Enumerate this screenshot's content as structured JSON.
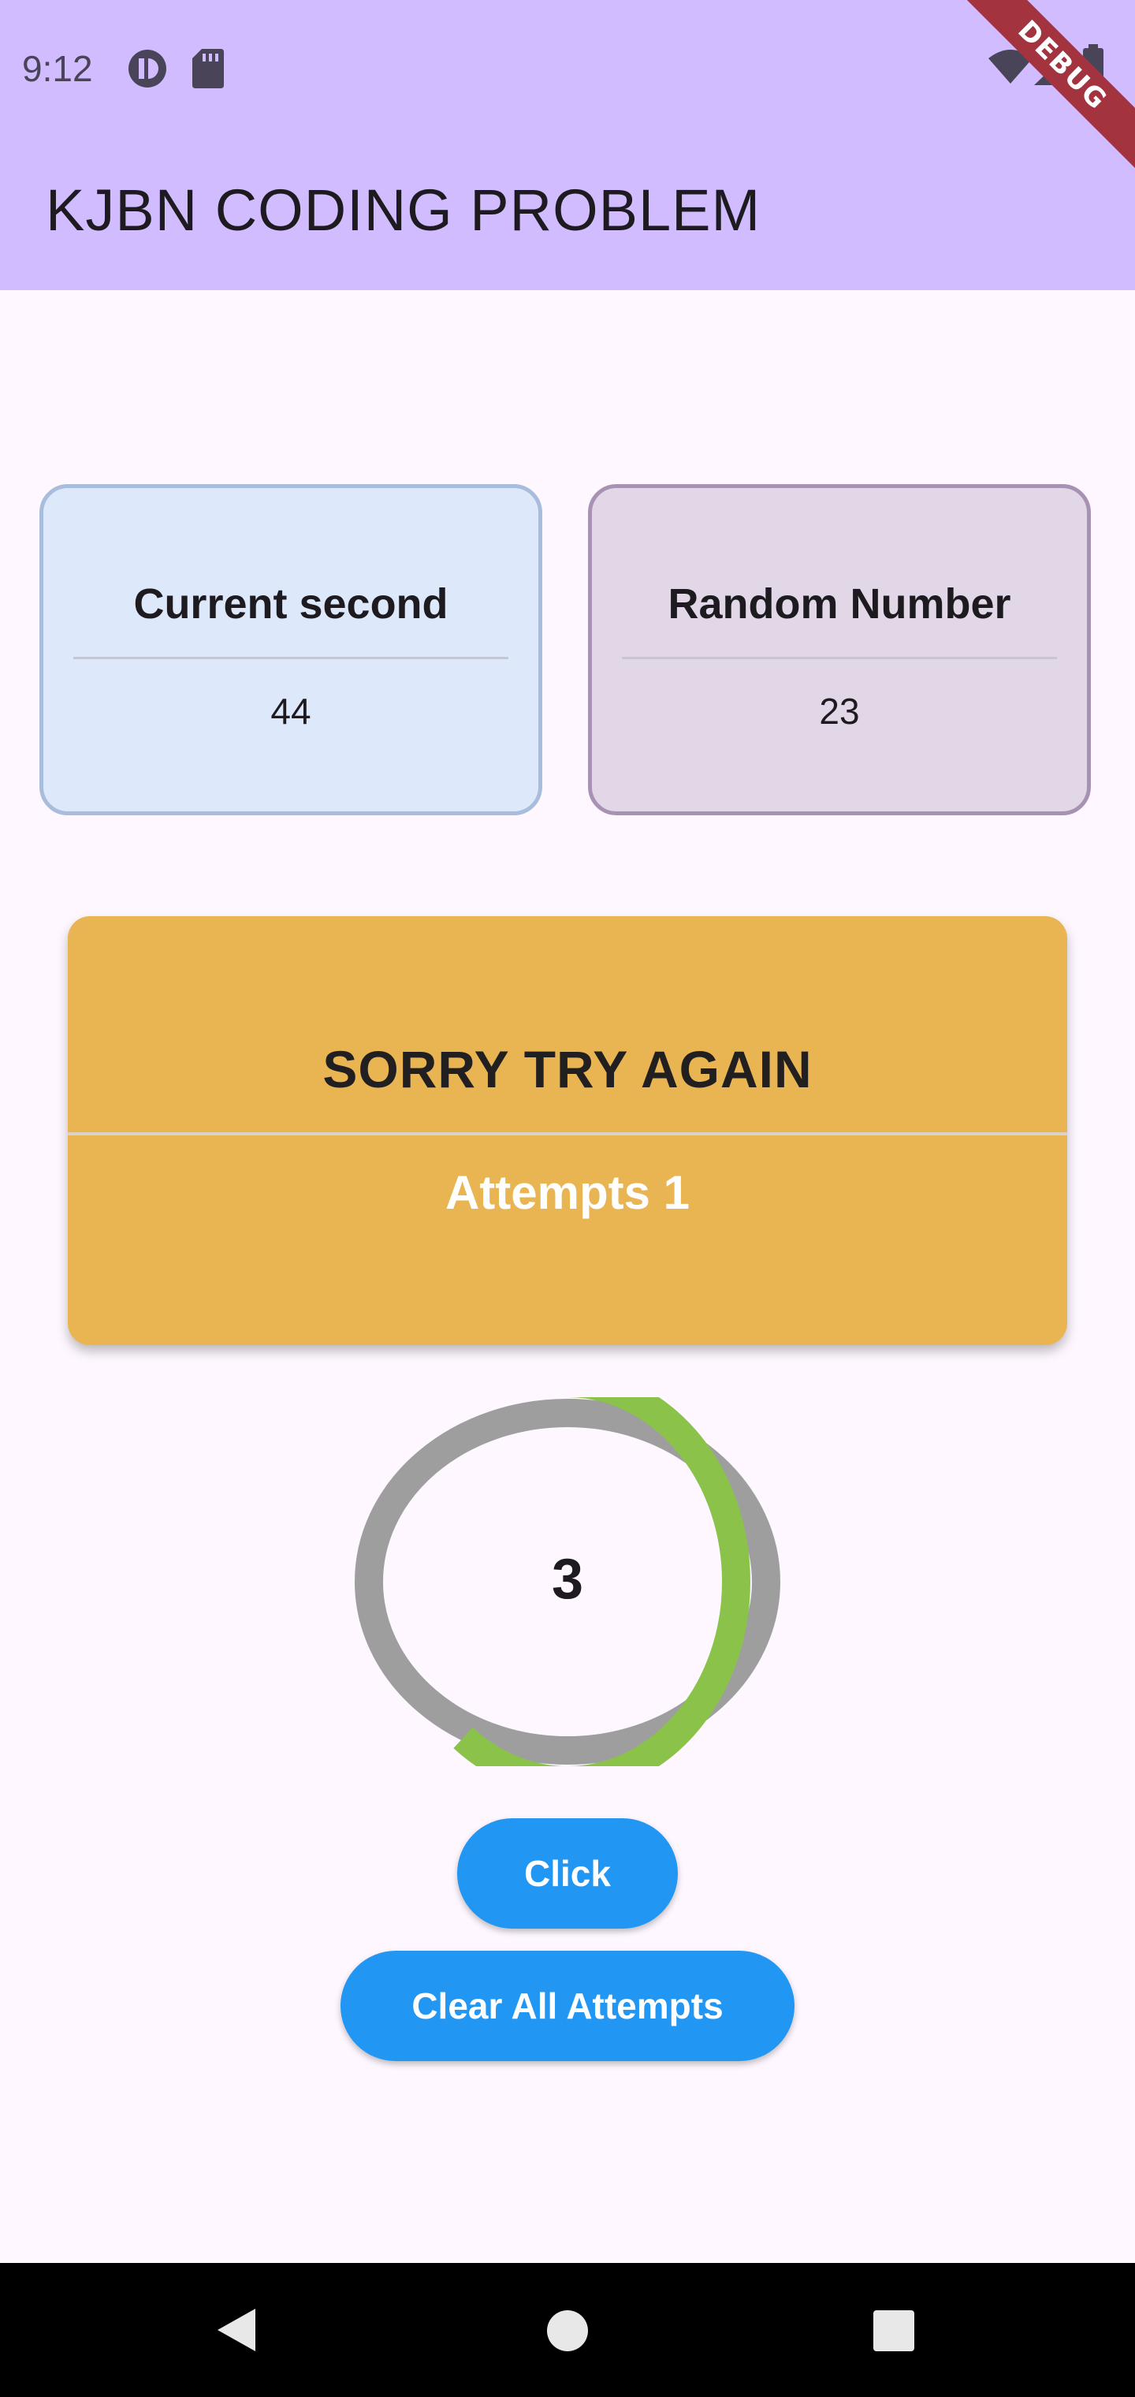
{
  "status_bar": {
    "time": "9:12",
    "icons": [
      "app-notification-icon",
      "sd-card-icon",
      "wifi-icon",
      "signal-icon",
      "battery-icon"
    ]
  },
  "debug_banner": {
    "label": "DEBUG"
  },
  "app_bar": {
    "title": "KJBN CODING PROBLEM"
  },
  "cards": {
    "current_second": {
      "title": "Current second",
      "value": "44"
    },
    "random_number": {
      "title": "Random Number",
      "value": "23"
    }
  },
  "result": {
    "title": "SORRY TRY AGAIN",
    "attempts": "Attempts 1"
  },
  "timer": {
    "count": "3",
    "progress_fraction": 0.6
  },
  "buttons": {
    "click": "Click",
    "clear": "Clear All Attempts"
  },
  "nav_bar": {
    "icons": [
      "back-icon",
      "home-icon",
      "recents-icon"
    ]
  },
  "colors": {
    "app_bar": "#d1bcff",
    "card_blue": "#dde8fa",
    "card_purple": "#e2d7e6",
    "result_card": "#e9b553",
    "ring_progress": "#8bc34a",
    "ring_track": "#9e9e9e",
    "button": "#2196f3"
  }
}
